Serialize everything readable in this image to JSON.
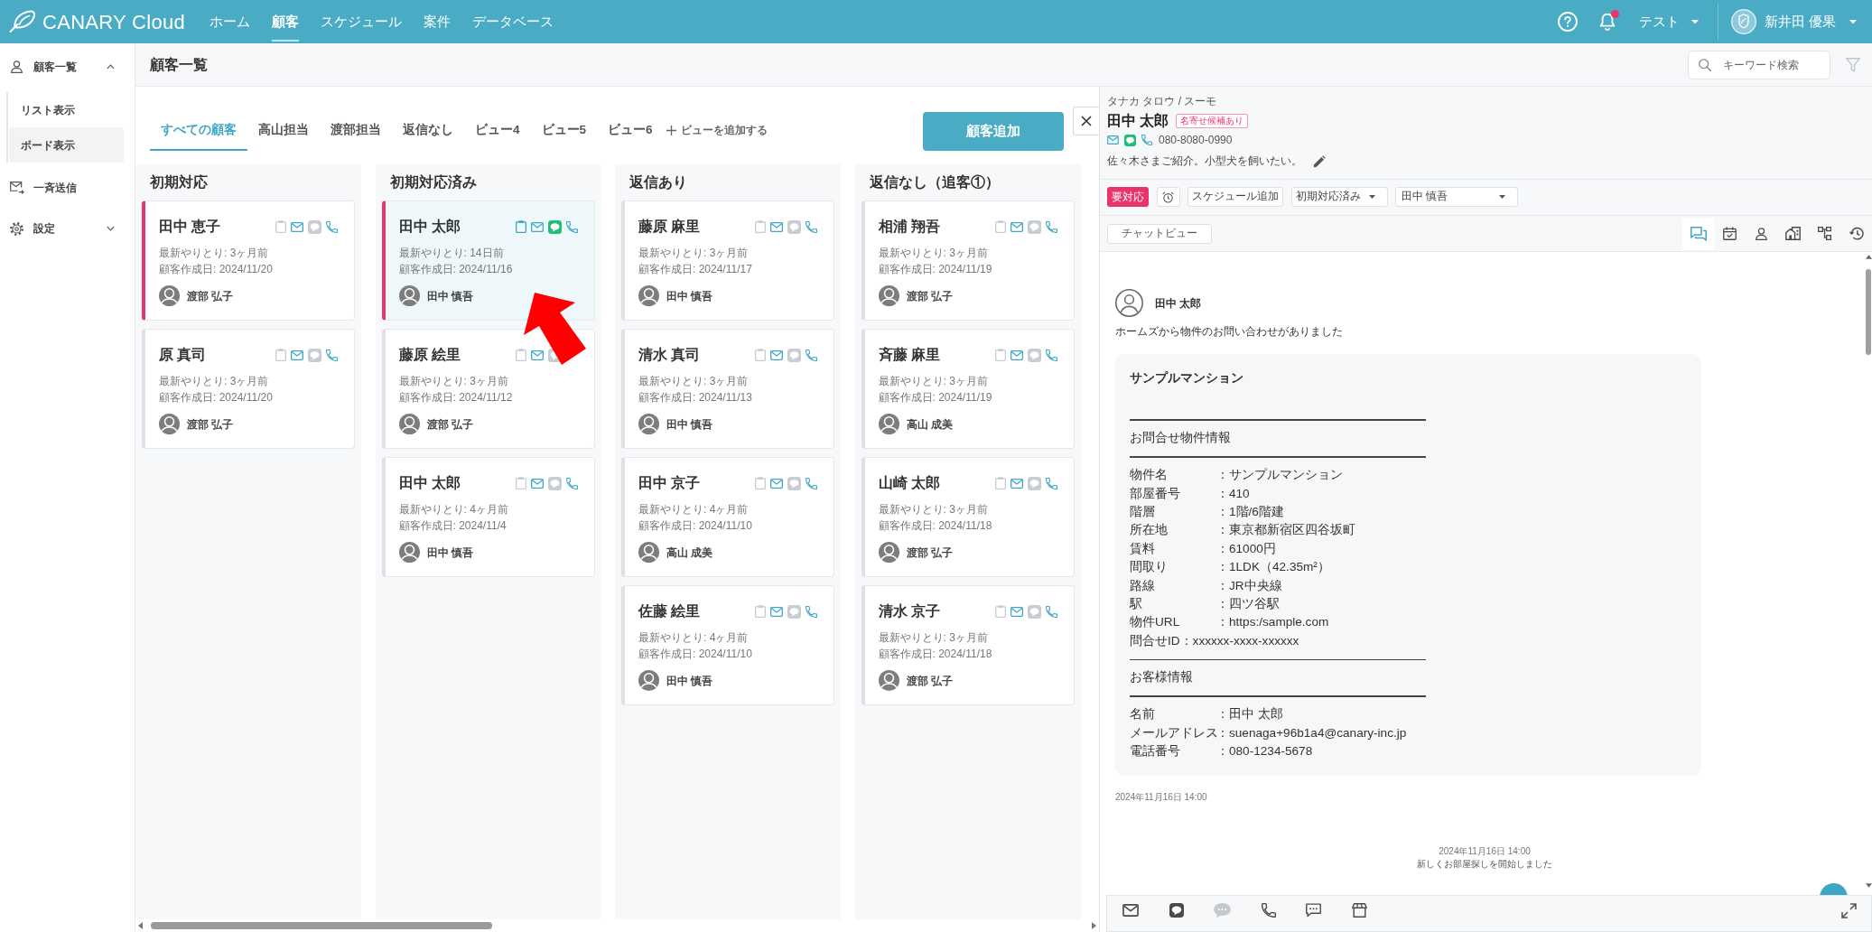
{
  "top_bar": {
    "logo": "CANARY Cloud",
    "nav": [
      {
        "label": "ホーム",
        "selected": false
      },
      {
        "label": "顧客",
        "selected": true
      },
      {
        "label": "スケジュール",
        "selected": false
      },
      {
        "label": "案件",
        "selected": false
      },
      {
        "label": "データベース",
        "selected": false
      }
    ],
    "notifications": {
      "unread": true
    },
    "workspace": "テスト",
    "user": "新井田 優果"
  },
  "sidebar": {
    "items": [
      {
        "label": "顧客一覧",
        "expanded": true,
        "children": [
          {
            "label": "リスト表示",
            "selected": false
          },
          {
            "label": "ボード表示",
            "selected": true
          }
        ]
      },
      {
        "label": "一斉送信"
      },
      {
        "label": "設定",
        "expanded": false
      }
    ]
  },
  "page_header": {
    "title": "顧客一覧",
    "search": {
      "placeholder": "キーワード検索"
    }
  },
  "views": {
    "tabs": [
      {
        "label": "すべての顧客",
        "selected": true
      },
      {
        "label": "高山担当",
        "selected": false
      },
      {
        "label": "渡部担当",
        "selected": false
      },
      {
        "label": "返信なし",
        "selected": false
      },
      {
        "label": "ビュー4",
        "selected": false
      },
      {
        "label": "ビュー5",
        "selected": false
      },
      {
        "label": "ビュー6",
        "selected": false
      }
    ],
    "add_view": "ビューを追加する",
    "add_customer": "顧客追加"
  },
  "board": {
    "columns": [
      {
        "title": "初期対応",
        "cards": [
          {
            "name": "田中 恵子",
            "last_contact": "最新やりとり: 3ヶ月前",
            "created": "顧客作成日: 2024/11/20",
            "assignee": "渡部 弘子",
            "flagged": true,
            "selected": false,
            "memo": false,
            "line": false
          },
          {
            "name": "原 真司",
            "last_contact": "最新やりとり: 3ヶ月前",
            "created": "顧客作成日: 2024/11/20",
            "assignee": "渡部 弘子",
            "flagged": false,
            "selected": false,
            "memo": false,
            "line": false
          }
        ]
      },
      {
        "title": "初期対応済み",
        "cards": [
          {
            "name": "田中 太郎",
            "last_contact": "最新やりとり: 14日前",
            "created": "顧客作成日: 2024/11/16",
            "assignee": "田中 慎吾",
            "flagged": true,
            "selected": true,
            "memo": true,
            "line": true
          },
          {
            "name": "藤原 絵里",
            "last_contact": "最新やりとり: 3ヶ月前",
            "created": "顧客作成日: 2024/11/12",
            "assignee": "渡部 弘子",
            "flagged": false,
            "selected": false,
            "memo": false,
            "line": false
          },
          {
            "name": "田中 太郎",
            "last_contact": "最新やりとり: 4ヶ月前",
            "created": "顧客作成日: 2024/11/4",
            "assignee": "田中 慎吾",
            "flagged": false,
            "selected": false,
            "memo": false,
            "line": false
          }
        ]
      },
      {
        "title": "返信あり",
        "cards": [
          {
            "name": "藤原 麻里",
            "last_contact": "最新やりとり: 3ヶ月前",
            "created": "顧客作成日: 2024/11/17",
            "assignee": "田中 慎吾",
            "flagged": false,
            "selected": false,
            "memo": false,
            "line": false
          },
          {
            "name": "清水 真司",
            "last_contact": "最新やりとり: 3ヶ月前",
            "created": "顧客作成日: 2024/11/13",
            "assignee": "田中 慎吾",
            "flagged": false,
            "selected": false,
            "memo": false,
            "line": false
          },
          {
            "name": "田中 京子",
            "last_contact": "最新やりとり: 4ヶ月前",
            "created": "顧客作成日: 2024/11/10",
            "assignee": "高山 成美",
            "flagged": false,
            "selected": false,
            "memo": false,
            "line": false
          },
          {
            "name": "佐藤 絵里",
            "last_contact": "最新やりとり: 4ヶ月前",
            "created": "顧客作成日: 2024/11/10",
            "assignee": "田中 慎吾",
            "flagged": false,
            "selected": false,
            "memo": false,
            "line": false
          }
        ]
      },
      {
        "title": "返信なし（追客①）",
        "cards": [
          {
            "name": "相浦 翔吾",
            "last_contact": "最新やりとり: 3ヶ月前",
            "created": "顧客作成日: 2024/11/19",
            "assignee": "渡部 弘子",
            "flagged": false,
            "selected": false,
            "memo": false,
            "line": false
          },
          {
            "name": "斉藤 麻里",
            "last_contact": "最新やりとり: 3ヶ月前",
            "created": "顧客作成日: 2024/11/19",
            "assignee": "高山 成美",
            "flagged": false,
            "selected": false,
            "memo": false,
            "line": false
          },
          {
            "name": "山崎 太郎",
            "last_contact": "最新やりとり: 3ヶ月前",
            "created": "顧客作成日: 2024/11/18",
            "assignee": "渡部 弘子",
            "flagged": false,
            "selected": false,
            "memo": false,
            "line": false
          },
          {
            "name": "清水 京子",
            "last_contact": "最新やりとり: 3ヶ月前",
            "created": "顧客作成日: 2024/11/18",
            "assignee": "渡部 弘子",
            "flagged": false,
            "selected": false,
            "memo": false,
            "line": false
          }
        ]
      }
    ]
  },
  "customer_panel": {
    "kana": "タナカ タロウ / スーモ",
    "name": "田中 太郎",
    "badge": "名寄せ候補あり",
    "line": true,
    "phone": "080-8080-0990",
    "note": "佐々木さまご紹介。小型犬を飼いたい。",
    "flag": {
      "label": "要対応",
      "on": true
    },
    "schedule_button": "スケジュール追加",
    "status": "初期対応済み",
    "assignee": "田中 慎吾",
    "chat_view_button": "チャットビュー",
    "view_tabs": [
      {
        "selected": true
      },
      {
        "selected": false
      },
      {
        "selected": false
      },
      {
        "selected": false
      },
      {
        "selected": false
      },
      {
        "selected": false
      }
    ],
    "messages": [
      {
        "kind": "inquiry",
        "sender": "田中 太郎",
        "text": "ホームズから物件のお問い合わせがありました",
        "card": {
          "title": "サンプルマンション",
          "lines": [
            {
              "kind": "rule"
            },
            {
              "kind": "heading",
              "text": "お問合せ物件情報"
            },
            {
              "kind": "rule"
            },
            {
              "kind": "field",
              "label": "物件名",
              "value": "：サンプルマンション"
            },
            {
              "kind": "field",
              "label": "部屋番号",
              "value": "：410"
            },
            {
              "kind": "field",
              "label": "階層",
              "value": "：1階/6階建"
            },
            {
              "kind": "field",
              "label": "所在地",
              "value": "：東京都新宿区四谷坂町"
            },
            {
              "kind": "field",
              "label": "賃料",
              "value": "：61000円"
            },
            {
              "kind": "field",
              "label": "間取り",
              "value": "：1LDK（42.35m²）"
            },
            {
              "kind": "field",
              "label": "路線",
              "value": "：JR中央線"
            },
            {
              "kind": "field",
              "label": "駅",
              "value": "：四ツ谷駅"
            },
            {
              "kind": "field",
              "label": "物件URL",
              "value": "：https:/sample.com"
            },
            {
              "kind": "text",
              "text": "問合せID：xxxxxx-xxxx-xxxxxx"
            },
            {
              "kind": "rule"
            },
            {
              "kind": "heading",
              "text": "お客様情報"
            },
            {
              "kind": "rule"
            },
            {
              "kind": "field",
              "label": "名前",
              "value": "：田中 太郎"
            },
            {
              "kind": "field",
              "label": "メールアドレス",
              "value": "：suenaga+96b1a4@canary-inc.jp"
            },
            {
              "kind": "field",
              "label": "電話番号",
              "value": "：080-1234-5678"
            }
          ]
        },
        "time": "2024年11月16日 14:00"
      },
      {
        "kind": "event",
        "time": "2024年11月16日 14:00",
        "text": "新しくお部屋探しを開始しました"
      }
    ],
    "composer": {
      "channels": [
        {
          "disabled": false
        },
        {
          "disabled": false
        },
        {
          "disabled": true
        },
        {
          "disabled": false
        },
        {
          "disabled": false
        },
        {
          "disabled": false
        }
      ]
    }
  }
}
